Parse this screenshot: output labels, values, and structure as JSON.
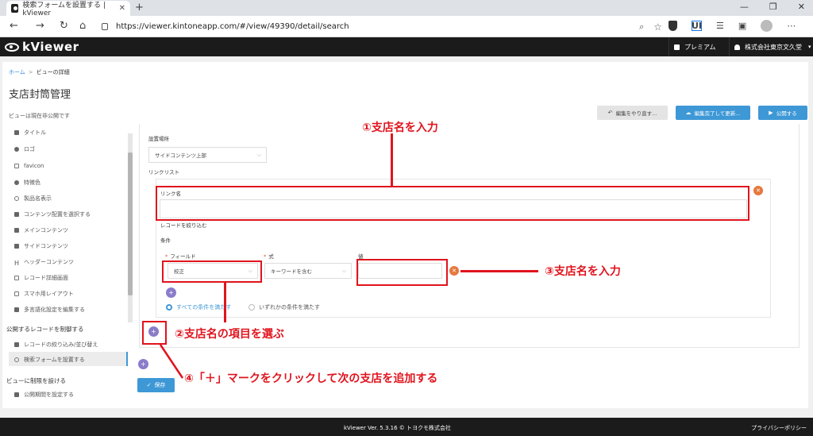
{
  "browser": {
    "tab_title": "検索フォームを設置する | kViewer",
    "url": "https://viewer.kintoneapp.com/#/view/49390/detail/search"
  },
  "app": {
    "logo": "kViewer",
    "premium": "プレミアム",
    "company": "株式会社東京文久堂"
  },
  "page": {
    "breadcrumb_home": "ホーム",
    "breadcrumb_current": "ビューの詳細",
    "title": "支店封筒管理",
    "publish_status": "ビューは現在非公開です",
    "buttons": {
      "redo": "編集をやり直す...",
      "done": "編集完了して更新...",
      "publish": "公開する"
    }
  },
  "sidebar": {
    "items": [
      {
        "label": "タイトル"
      },
      {
        "label": "ロゴ"
      },
      {
        "label": "favicon"
      },
      {
        "label": "特徴色"
      },
      {
        "label": "製品名表示"
      },
      {
        "label": "コンテンツ配置を選択する"
      },
      {
        "label": "メインコンテンツ"
      },
      {
        "label": "サイドコンテンツ"
      },
      {
        "label": "ヘッダーコンテンツ"
      },
      {
        "label": "レコード詳細画面"
      },
      {
        "label": "スマホ用レイアウト"
      },
      {
        "label": "多言語化設定を編集する"
      }
    ],
    "section_records": "公開するレコードを制御する",
    "records_items": [
      {
        "label": "レコードの絞り込み/並び替え"
      },
      {
        "label": "検索フォームを設置する"
      }
    ],
    "section_limits": "ビューに制限を設ける",
    "limits_items": [
      {
        "label": "公開期間を設定する"
      }
    ]
  },
  "form": {
    "placement_label": "設置場所",
    "placement_value": "サイドコンテンツ上部",
    "linklist_label": "リンクリスト",
    "linkname_label": "リンク名",
    "linkname_value": "",
    "filter_label": "レコードを絞り込む",
    "conditions_label": "条件",
    "field_label": "フィールド",
    "field_value": "校正",
    "operator_label": "式",
    "operator_value": "キーワードを含む",
    "value_label": "値",
    "value_value": "",
    "radio_all": "すべての条件を満たす",
    "radio_any": "いずれかの条件を満たす",
    "save_label": "保存"
  },
  "annotations": {
    "a1": "①支店名を入力",
    "a2": "②支店名の項目を選ぶ",
    "a3": "③支店名を入力",
    "a4": "④「＋」マークをクリックして次の支店を追加する"
  },
  "footer": {
    "version": "kViewer  Ver. 5.3.16  © トヨクモ株式会社",
    "policy": "プライバシーポリシー"
  },
  "colors": {
    "accent": "#3e98d6",
    "annotation": "#e0141e",
    "header_bg": "#1b1b1b"
  }
}
